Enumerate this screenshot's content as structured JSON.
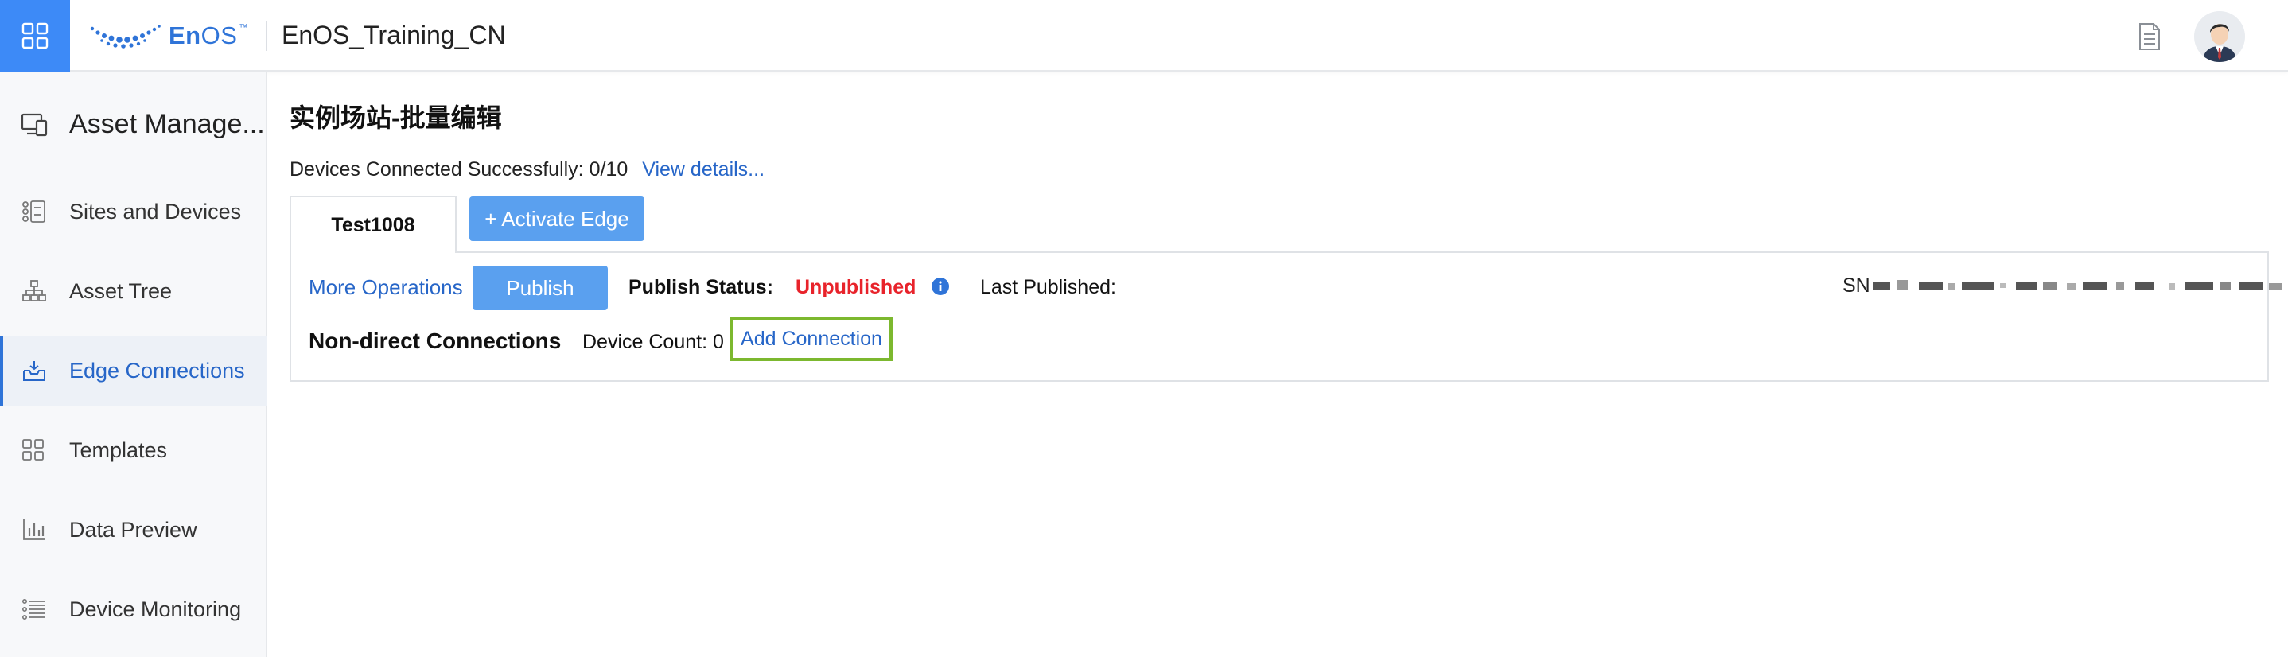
{
  "header": {
    "brand_bold": "En",
    "brand_light": "OS",
    "brand_tm": "™",
    "org_title": "EnOS_Training_CN"
  },
  "sidebar": {
    "module_title": "Asset Manage...",
    "items": [
      {
        "label": "Sites and Devices",
        "icon": "sites-devices-icon",
        "active": false
      },
      {
        "label": "Asset Tree",
        "icon": "asset-tree-icon",
        "active": false
      },
      {
        "label": "Edge Connections",
        "icon": "inbox-icon",
        "active": true
      },
      {
        "label": "Templates",
        "icon": "template-grid-icon",
        "active": false
      },
      {
        "label": "Data Preview",
        "icon": "bar-chart-icon",
        "active": false
      },
      {
        "label": "Device Monitoring",
        "icon": "list-icon",
        "active": false
      }
    ]
  },
  "main": {
    "page_title": "实例场站-批量编辑",
    "devices_connected": "Devices Connected Successfully: 0/10",
    "view_details": "View details...",
    "edge_tab": "Test1008",
    "activate_edge": "+ Activate Edge",
    "panel": {
      "more_operations": "More Operations",
      "publish": "Publish",
      "publish_status_label": "Publish Status:",
      "publish_status_value": "Unpublished",
      "last_published": "Last Published:",
      "sn_prefix": "SN",
      "non_direct_title": "Non-direct Connections",
      "device_count": "Device Count: 0",
      "add_connection": "Add Connection"
    }
  },
  "colors": {
    "accent": "#3d8af7",
    "button": "#5aa0ef",
    "link": "#2766c8",
    "status_red": "#e8232b",
    "highlight_green": "#7cb82f"
  }
}
